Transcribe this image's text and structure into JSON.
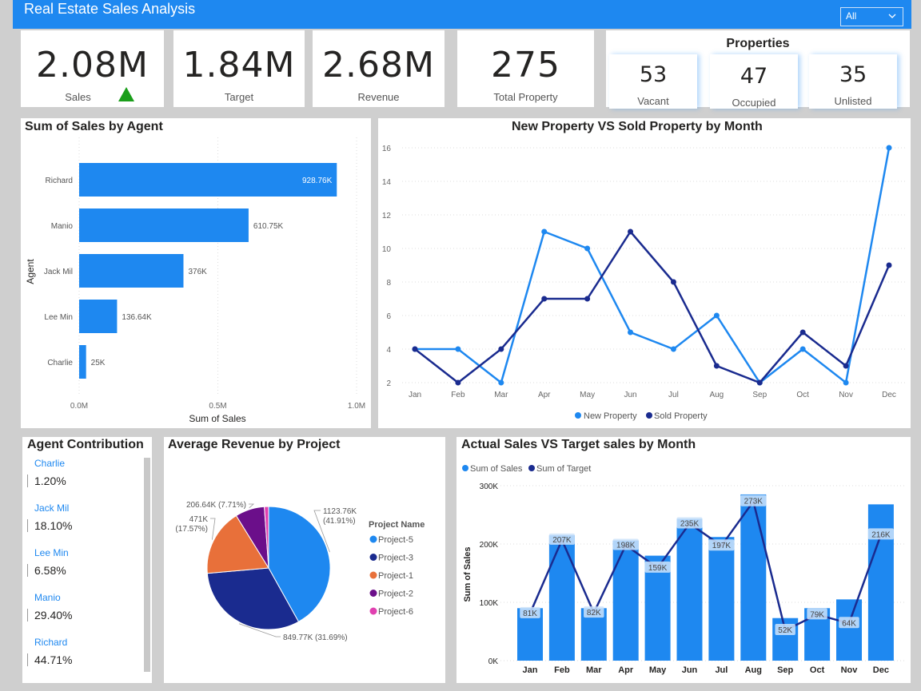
{
  "header": {
    "title": "Real Estate Sales Analysis",
    "slicer_value": "All"
  },
  "kpis": [
    {
      "value": "2.08M",
      "label": "Sales"
    },
    {
      "value": "1.84M",
      "label": "Target"
    },
    {
      "value": "2.68M",
      "label": "Revenue"
    },
    {
      "value": "275",
      "label": "Total Property"
    }
  ],
  "kpi_indicator_color": "#1a9e1a",
  "properties": {
    "title": "Properties",
    "items": [
      {
        "value": "53",
        "label": "Vacant"
      },
      {
        "value": "47",
        "label": "Occupied"
      },
      {
        "value": "35",
        "label": "Unlisted"
      }
    ]
  },
  "agent_contribution": {
    "title": "Agent Contribution",
    "items": [
      {
        "name": "Charlie",
        "value": "1.20%"
      },
      {
        "name": "Jack Mil",
        "value": "18.10%"
      },
      {
        "name": "Lee Min",
        "value": "6.58%"
      },
      {
        "name": "Manio",
        "value": "29.40%"
      },
      {
        "name": "Richard",
        "value": "44.71%"
      }
    ]
  },
  "colors": {
    "primary": "#1e88f0",
    "dark": "#1a2b8f",
    "orange": "#e8703a",
    "purple": "#6b0f8a",
    "pink": "#e040b0"
  },
  "chart_data": [
    {
      "id": "sales_by_agent",
      "type": "bar",
      "orientation": "horizontal",
      "title": "Sum of Sales by Agent",
      "xlabel": "Sum of Sales",
      "ylabel": "Agent",
      "categories": [
        "Richard",
        "Manio",
        "Jack Mil",
        "Lee Min",
        "Charlie"
      ],
      "values": [
        928760,
        610750,
        376000,
        136640,
        25000
      ],
      "data_labels": [
        "928.76K",
        "610.75K",
        "376K",
        "136.64K",
        "25K"
      ],
      "xticks": [
        "0.0M",
        "0.5M",
        "1.0M"
      ],
      "xlim": [
        0,
        1000000
      ]
    },
    {
      "id": "new_vs_sold",
      "type": "line",
      "title": "New Property VS Sold Property by Month",
      "categories": [
        "Jan",
        "Feb",
        "Mar",
        "Apr",
        "May",
        "Jun",
        "Jul",
        "Aug",
        "Sep",
        "Oct",
        "Nov",
        "Dec"
      ],
      "series": [
        {
          "name": "New Property",
          "values": [
            4,
            4,
            2,
            11,
            10,
            5,
            4,
            6,
            2,
            4,
            2,
            16
          ]
        },
        {
          "name": "Sold Property",
          "values": [
            4,
            2,
            4,
            7,
            7,
            11,
            8,
            3,
            2,
            5,
            3,
            9
          ]
        }
      ],
      "yticks": [
        "2",
        "4",
        "6",
        "8",
        "10",
        "12",
        "14",
        "16"
      ],
      "ylim": [
        2,
        16
      ],
      "legend": "bottom"
    },
    {
      "id": "avg_revenue_by_project",
      "type": "pie",
      "title": "Average Revenue by Project",
      "legend_title": "Project Name",
      "legend": "right",
      "slices": [
        {
          "name": "Project-5",
          "value": 1123760,
          "label": "1123.76K",
          "pct": "(41.91%)"
        },
        {
          "name": "Project-3",
          "value": 849770,
          "label": "849.77K (31.69%)"
        },
        {
          "name": "Project-1",
          "value": 471000,
          "label": "471K",
          "pct": "(17.57%)"
        },
        {
          "name": "Project-2",
          "value": 206640,
          "label": "206.64K (7.71%)"
        },
        {
          "name": "Project-6",
          "value": 30000
        }
      ]
    },
    {
      "id": "actual_vs_target",
      "type": "bar",
      "title": "Actual Sales VS Target sales by Month",
      "ylabel": "Sum of Sales",
      "categories": [
        "Jan",
        "Feb",
        "Mar",
        "Apr",
        "May",
        "Jun",
        "Jul",
        "Aug",
        "Sep",
        "Oct",
        "Nov",
        "Dec"
      ],
      "series": [
        {
          "name": "Sum of Sales",
          "type": "bar",
          "values": [
            90000,
            215000,
            90000,
            206000,
            180000,
            243000,
            212000,
            285000,
            73000,
            90000,
            105000,
            268000
          ]
        },
        {
          "name": "Sum of Target",
          "type": "line",
          "values": [
            81000,
            207000,
            82000,
            198000,
            159000,
            235000,
            197000,
            273000,
            52000,
            79000,
            64000,
            216000
          ]
        }
      ],
      "data_labels": [
        "81K",
        "207K",
        "82K",
        "198K",
        "159K",
        "235K",
        "197K",
        "273K",
        "52K",
        "79K",
        "64K",
        "216K"
      ],
      "yticks": [
        "0K",
        "100K",
        "200K",
        "300K"
      ],
      "ylim": [
        0,
        300000
      ],
      "legend": "top-left"
    }
  ]
}
